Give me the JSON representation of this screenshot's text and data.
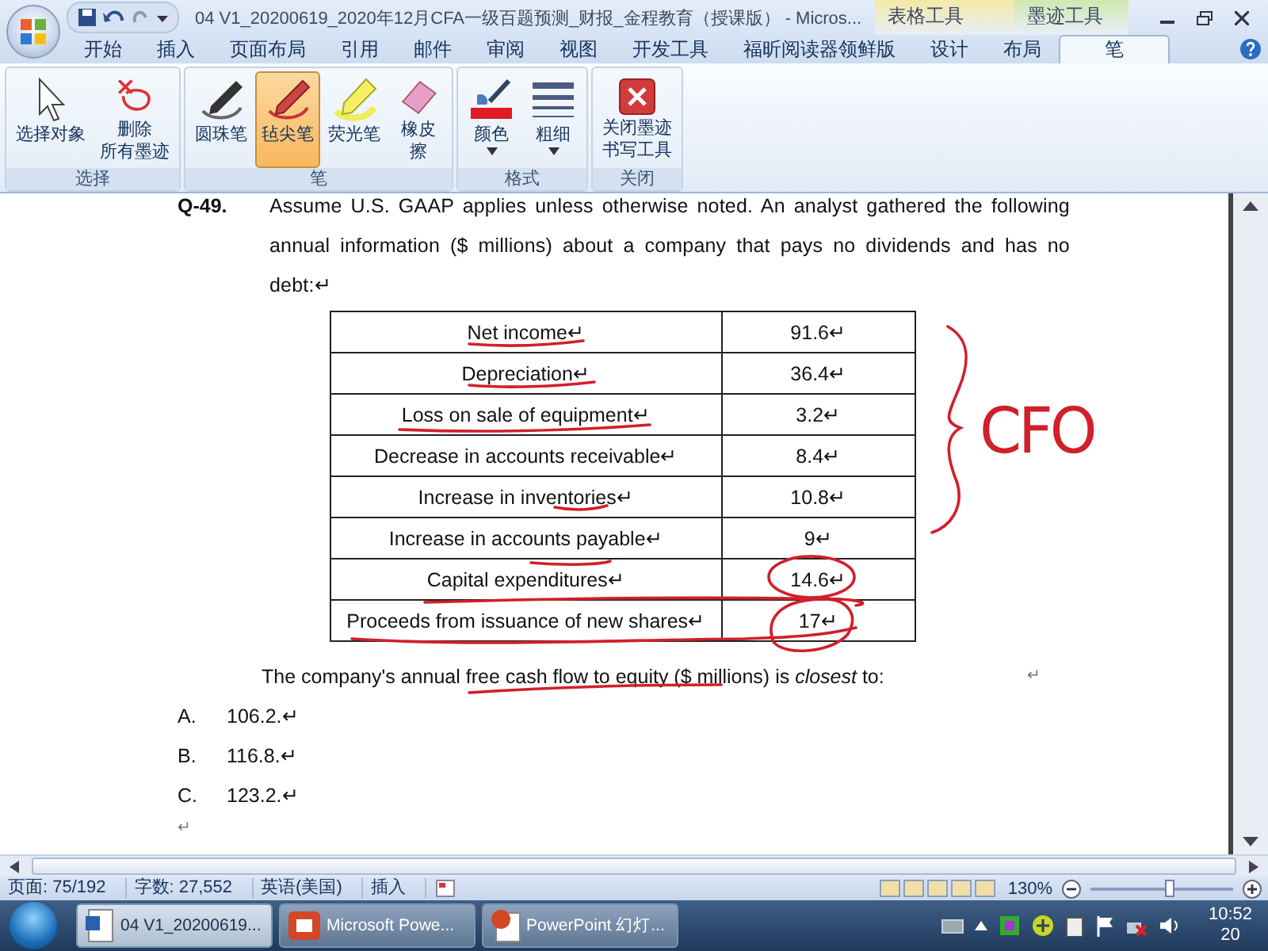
{
  "window": {
    "title": "04 V1_20200619_2020年12月CFA一级百题预测_财报_金程教育（授课版） - Micros..."
  },
  "contextual_groups": [
    {
      "label": "表格工具",
      "color": "#f3e9a6"
    },
    {
      "label": "墨迹工具",
      "color": "#cfe9b0"
    }
  ],
  "tabs": [
    {
      "label": "开始",
      "selected": false
    },
    {
      "label": "插入",
      "selected": false
    },
    {
      "label": "页面布局",
      "selected": false
    },
    {
      "label": "引用",
      "selected": false
    },
    {
      "label": "邮件",
      "selected": false
    },
    {
      "label": "审阅",
      "selected": false
    },
    {
      "label": "视图",
      "selected": false
    },
    {
      "label": "开发工具",
      "selected": false
    },
    {
      "label": "福昕阅读器领鲜版",
      "selected": false
    },
    {
      "label": "设计",
      "selected": false
    },
    {
      "label": "布局",
      "selected": false
    },
    {
      "label": "笔",
      "selected": true
    }
  ],
  "ribbon": {
    "groups": [
      {
        "label": "选择",
        "tools": [
          {
            "kind": "cursor",
            "lines": [
              "选择对象"
            ],
            "selected": false,
            "has_menu": false
          },
          {
            "kind": "erase-all",
            "lines": [
              "删除",
              "所有墨迹"
            ],
            "selected": false,
            "has_menu": false
          }
        ]
      },
      {
        "label": "笔",
        "tools": [
          {
            "kind": "pen",
            "lines": [
              "圆珠笔"
            ],
            "selected": false,
            "has_menu": false
          },
          {
            "kind": "felt-pen",
            "lines": [
              "毡尖笔"
            ],
            "selected": true,
            "has_menu": false
          },
          {
            "kind": "highlighter",
            "lines": [
              "荧光笔"
            ],
            "selected": false,
            "has_menu": false
          },
          {
            "kind": "eraser",
            "lines": [
              "橡皮",
              "擦"
            ],
            "selected": false,
            "has_menu": false
          }
        ]
      },
      {
        "label": "格式",
        "tools": [
          {
            "kind": "color",
            "lines": [
              "颜色"
            ],
            "selected": false,
            "has_menu": true
          },
          {
            "kind": "weight",
            "lines": [
              "粗细"
            ],
            "selected": false,
            "has_menu": true
          }
        ]
      },
      {
        "label": "关闭",
        "tools": [
          {
            "kind": "close",
            "lines": [
              "关闭墨迹",
              "书写工具"
            ],
            "selected": false,
            "has_menu": false
          }
        ]
      }
    ]
  },
  "document": {
    "question_number": "Q-49.",
    "stem": "Assume U.S. GAAP applies unless otherwise noted. An analyst gathered the following annual information ($ millions) about a company that pays no dividends and has no debt:↵",
    "table": {
      "rows": [
        {
          "item": "Net income↵",
          "value": "91.6↵"
        },
        {
          "item": "Depreciation↵",
          "value": "36.4↵"
        },
        {
          "item": "Loss on sale of equipment↵",
          "value": "3.2↵"
        },
        {
          "item": "Decrease in accounts receivable↵",
          "value": "8.4↵"
        },
        {
          "item": "Increase in inventories↵",
          "value": "10.8↵"
        },
        {
          "item": "Increase in accounts payable↵",
          "value": "9↵"
        },
        {
          "item": "Capital expenditures↵",
          "value": "14.6↵"
        },
        {
          "item": "Proceeds from issuance of new shares↵",
          "value": "17↵"
        }
      ]
    },
    "prompt": "The company's annual free cash flow to equity ($ millions) is *closest* to:",
    "prompt_end_mark": "↵",
    "options": [
      {
        "letter": "A.",
        "text": "106.2.↵"
      },
      {
        "letter": "B.",
        "text": "116.8.↵"
      },
      {
        "letter": "C.",
        "text": "123.2.↵"
      }
    ],
    "trailing_mark": "↵",
    "handwritten_label": "CFO"
  },
  "status_bar": {
    "items": [
      "页面: 75/192",
      "字数: 27,552",
      "英语(美国)",
      "插入"
    ],
    "zoom": "130%",
    "zoom_level": {
      "level": 0.55
    }
  },
  "taskbar": {
    "items": [
      {
        "label": "04 V1_20200619...",
        "kind": "word",
        "selected": true
      },
      {
        "label": "Microsoft Powe...",
        "kind": "powerpoint",
        "selected": false
      },
      {
        "label": "PowerPoint 幻灯...",
        "kind": "slides",
        "selected": false
      }
    ],
    "time": "10:52",
    "date": "20"
  }
}
